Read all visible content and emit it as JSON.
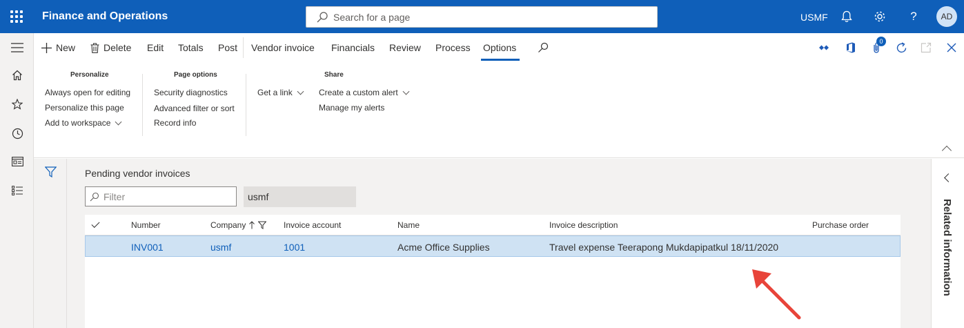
{
  "topbar": {
    "app_title": "Finance and Operations",
    "search_placeholder": "Search for a page",
    "company": "USMF",
    "notification_count": "0",
    "avatar_initials": "AD"
  },
  "actionbar": {
    "new_label": "New",
    "delete_label": "Delete",
    "edit_label": "Edit",
    "totals_label": "Totals",
    "post_label": "Post",
    "tabs": [
      "Vendor invoice",
      "Financials",
      "Review",
      "Process",
      "Options"
    ],
    "active_tab": "Options",
    "badge_count": "0"
  },
  "ribbon": {
    "personalize": {
      "title": "Personalize",
      "items": [
        "Always open for editing",
        "Personalize this page",
        "Add to workspace"
      ]
    },
    "page_options": {
      "title": "Page options",
      "items": [
        "Security diagnostics",
        "Advanced filter or sort",
        "Record info"
      ]
    },
    "get_link": "Get a link",
    "share": {
      "title": "Share",
      "items": [
        "Create a custom alert",
        "Manage my alerts"
      ]
    }
  },
  "list": {
    "title": "Pending vendor invoices",
    "filter_placeholder": "Filter",
    "company_value": "usmf",
    "columns": [
      "Number",
      "Company",
      "Invoice account",
      "Name",
      "Invoice description",
      "Purchase order"
    ],
    "rows": [
      {
        "number": "INV001",
        "company": "usmf",
        "invoice_account": "1001",
        "name": "Acme Office Supplies",
        "invoice_description": "Travel expense Teerapong Mukdapipatkul 18/11/2020",
        "purchase_order": ""
      }
    ]
  },
  "related": {
    "label": "Related information"
  },
  "colors": {
    "brand": "#0f5fb9",
    "selected_row": "#cfe2f3",
    "annotation_arrow": "#e8443a"
  }
}
